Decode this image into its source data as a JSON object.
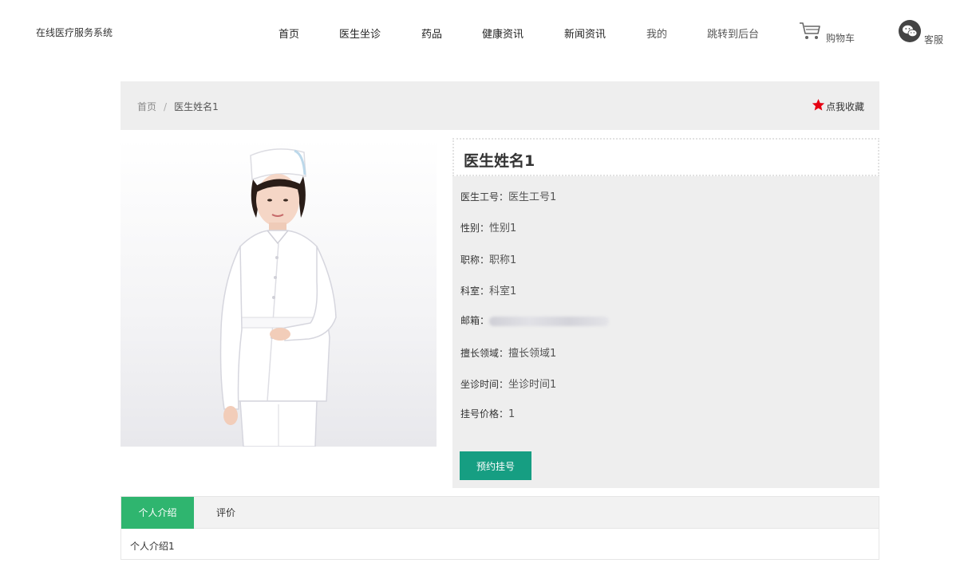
{
  "header": {
    "site_name": "在线医疗服务系统",
    "nav": [
      {
        "label": "首页"
      },
      {
        "label": "医生坐诊"
      },
      {
        "label": "药品"
      },
      {
        "label": "健康资讯"
      },
      {
        "label": "新闻资讯"
      },
      {
        "label": "我的"
      },
      {
        "label": "跳转到后台"
      }
    ],
    "cart": {
      "label": "购物车",
      "icon": "cart-icon"
    },
    "service": {
      "label": "客服",
      "icon": "wechat-icon"
    }
  },
  "breadcrumb": {
    "home": "首页",
    "separator": "/",
    "current": "医生姓名1"
  },
  "favorite": {
    "label": "点我收藏",
    "icon": "star-icon",
    "icon_color": "#e60012"
  },
  "doctor": {
    "name": "医生姓名1",
    "fields": [
      {
        "key": "医生工号：",
        "value": "医生工号1"
      },
      {
        "key": "性别：",
        "value": "性别1"
      },
      {
        "key": "职称：",
        "value": "职称1"
      },
      {
        "key": "科室：",
        "value": "科室1"
      },
      {
        "key": "邮箱：",
        "value": ""
      },
      {
        "key": "擅长领域：",
        "value": "擅长领域1"
      },
      {
        "key": "坐诊时间：",
        "value": "坐诊时间1"
      },
      {
        "key": "挂号价格：",
        "value": "1"
      }
    ],
    "book_button": "预约挂号"
  },
  "tabs": {
    "items": [
      {
        "label": "个人介绍"
      },
      {
        "label": "评价"
      }
    ],
    "content": "个人介绍1"
  },
  "colors": {
    "accent_button": "#169e82",
    "active_tab": "#2fb56f",
    "panel_bg": "#eeeeee"
  }
}
